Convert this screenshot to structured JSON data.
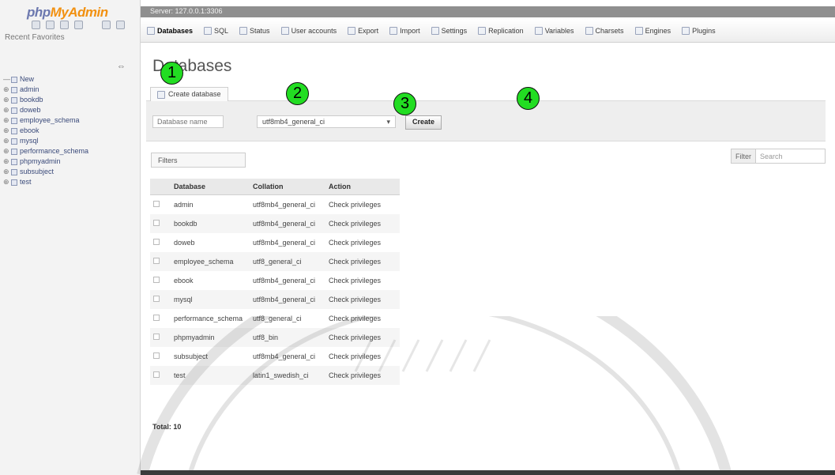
{
  "sidebar": {
    "logo_php": "php",
    "logo_myadmin": "MyAdmin",
    "recent_label": "Recent  Favorites",
    "collapse_symbol": "⇔",
    "databases": [
      {
        "expander": "—",
        "label": "New"
      },
      {
        "expander": "⊕",
        "label": "admin"
      },
      {
        "expander": "⊕",
        "label": "bookdb"
      },
      {
        "expander": "⊕",
        "label": "doweb"
      },
      {
        "expander": "⊕",
        "label": "employee_schema"
      },
      {
        "expander": "⊕",
        "label": "ebook"
      },
      {
        "expander": "⊕",
        "label": "mysql"
      },
      {
        "expander": "⊕",
        "label": "performance_schema"
      },
      {
        "expander": "⊕",
        "label": "phpmyadmin"
      },
      {
        "expander": "⊕",
        "label": "subsubject"
      },
      {
        "expander": "⊕",
        "label": "test"
      }
    ]
  },
  "topbar": {
    "server_label": "Server: 127.0.0.1:3306"
  },
  "tabs": [
    {
      "label": "Databases",
      "icon": "database-icon"
    },
    {
      "label": "SQL",
      "icon": "sql-icon"
    },
    {
      "label": "Status",
      "icon": "status-icon"
    },
    {
      "label": "User accounts",
      "icon": "users-icon"
    },
    {
      "label": "Export",
      "icon": "export-icon"
    },
    {
      "label": "Import",
      "icon": "import-icon"
    },
    {
      "label": "Settings",
      "icon": "settings-icon"
    },
    {
      "label": "Replication",
      "icon": "replication-icon"
    },
    {
      "label": "Variables",
      "icon": "variables-icon"
    },
    {
      "label": "Charsets",
      "icon": "charsets-icon"
    },
    {
      "label": "Engines",
      "icon": "engines-icon"
    },
    {
      "label": "Plugins",
      "icon": "plugins-icon"
    }
  ],
  "main": {
    "title": "Databases",
    "create_db_label": "Create database",
    "db_name_placeholder": "Database name",
    "collation_value": "utf8mb4_general_ci",
    "create_button": "Create",
    "filter_label": "Filters",
    "search_label": "Filter",
    "search_placeholder": "Search",
    "table_headers": [
      "Database",
      "Collation",
      "Action"
    ],
    "rows": [
      {
        "name": "admin",
        "collation": "utf8mb4_general_ci",
        "action": "Check privileges"
      },
      {
        "name": "bookdb",
        "collation": "utf8mb4_general_ci",
        "action": "Check privileges"
      },
      {
        "name": "doweb",
        "collation": "utf8mb4_general_ci",
        "action": "Check privileges"
      },
      {
        "name": "employee_schema",
        "collation": "utf8_general_ci",
        "action": "Check privileges"
      },
      {
        "name": "ebook",
        "collation": "utf8mb4_general_ci",
        "action": "Check privileges"
      },
      {
        "name": "mysql",
        "collation": "utf8mb4_general_ci",
        "action": "Check privileges"
      },
      {
        "name": "performance_schema",
        "collation": "utf8_general_ci",
        "action": "Check privileges"
      },
      {
        "name": "phpmyadmin",
        "collation": "utf8_bin",
        "action": "Check privileges"
      },
      {
        "name": "subsubject",
        "collation": "utf8mb4_general_ci",
        "action": "Check privileges"
      },
      {
        "name": "test",
        "collation": "latin1_swedish_ci",
        "action": "Check privileges"
      }
    ],
    "total_label": "Total: 10"
  },
  "callouts": [
    "1",
    "2",
    "3",
    "4"
  ],
  "colors": {
    "callout_green": "#22dd22",
    "logo_blue": "#6c78af",
    "logo_orange": "#f29111"
  }
}
